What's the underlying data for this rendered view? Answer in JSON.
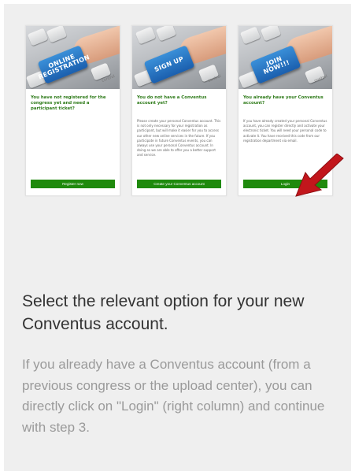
{
  "cards": [
    {
      "key_label": "ONLINE\nREGISTRATION",
      "key_caption": "control",
      "title": "You have not registered for the congress yet and need a participant ticket?",
      "body": "",
      "button": "Register now"
    },
    {
      "key_label": "SIGN UP",
      "key_caption": "control",
      "title": "You do not have a Conventus account yet?",
      "body": "Please create your personal Conventus account. This is not only necessary for your registration as participant, but will make it easier for you to access our other new online services in the future. If you participate in future Conventus events, you can always use your personal Conventus account. In doing so we are able to offer you a better support and service.",
      "button": "Create your Conventus account"
    },
    {
      "key_label": "JOIN\nNOW!!!",
      "key_caption": "control",
      "title": "You already have your Conventus account?",
      "body": "If you have already created your personal Conventus account, you can register directly and activate your electronic ticket. You will need your personal code to activate it. You have received this code from our registration department via email.",
      "button": "Login"
    }
  ],
  "heading": "Select the relevant option for your new Conventus account.",
  "description": "If you already have a Conventus account (from a previous congress or the upload center), you can directly click on \"Login\" (right column) and continue with step 3.",
  "colors": {
    "panel_bg": "#efefef",
    "button_green": "#1f8a0d",
    "title_green": "#2d7a18",
    "arrow_red": "#c2161c",
    "key_blue": "#1b5fae"
  },
  "icons": [
    "arrow-pointer-icon"
  ]
}
